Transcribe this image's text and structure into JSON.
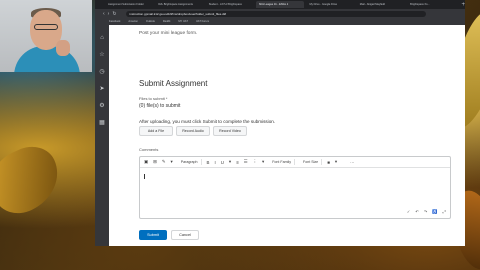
{
  "browser": {
    "tabs": [
      {
        "label": "Assignment Submission Folder"
      },
      {
        "label": "D2L Brightspace Assignments"
      },
      {
        "label": "Student - LX7L3 Brightspace"
      },
      {
        "label": "Mini League 1b - ENGL 1"
      },
      {
        "label": "My Drive - Google Drive"
      },
      {
        "label": "Mail - Abigail Mayfield"
      },
      {
        "label": "Brightspace fro..."
      }
    ],
    "url": "instruction.gpmail.k12.ga.us/d2l/lms/dropbox/user/folder_submit_files.d2l",
    "bookmarks": [
      "Facebook",
      "Amazon",
      "Outlook",
      "Reddit",
      "MY UAT",
      "UAT Forum"
    ]
  },
  "page": {
    "post_link": "Post your mini league form.",
    "heading": "Submit Assignment",
    "files_label": "Files to submit *",
    "files_value": "(0) file(s) to submit",
    "instructions": "After uploading, you must click Submit to complete the submission.",
    "add_file": "Add a File",
    "record_audio": "Record Audio",
    "record_video": "Record Video",
    "comments_label": "Comments",
    "toolbar": {
      "paragraph": "Paragraph",
      "bold": "B",
      "italic": "I",
      "underline": "U",
      "font_family": "Font Family",
      "font_size": "Font Size",
      "more": "···"
    },
    "submit": "Submit",
    "cancel": "Cancel"
  }
}
